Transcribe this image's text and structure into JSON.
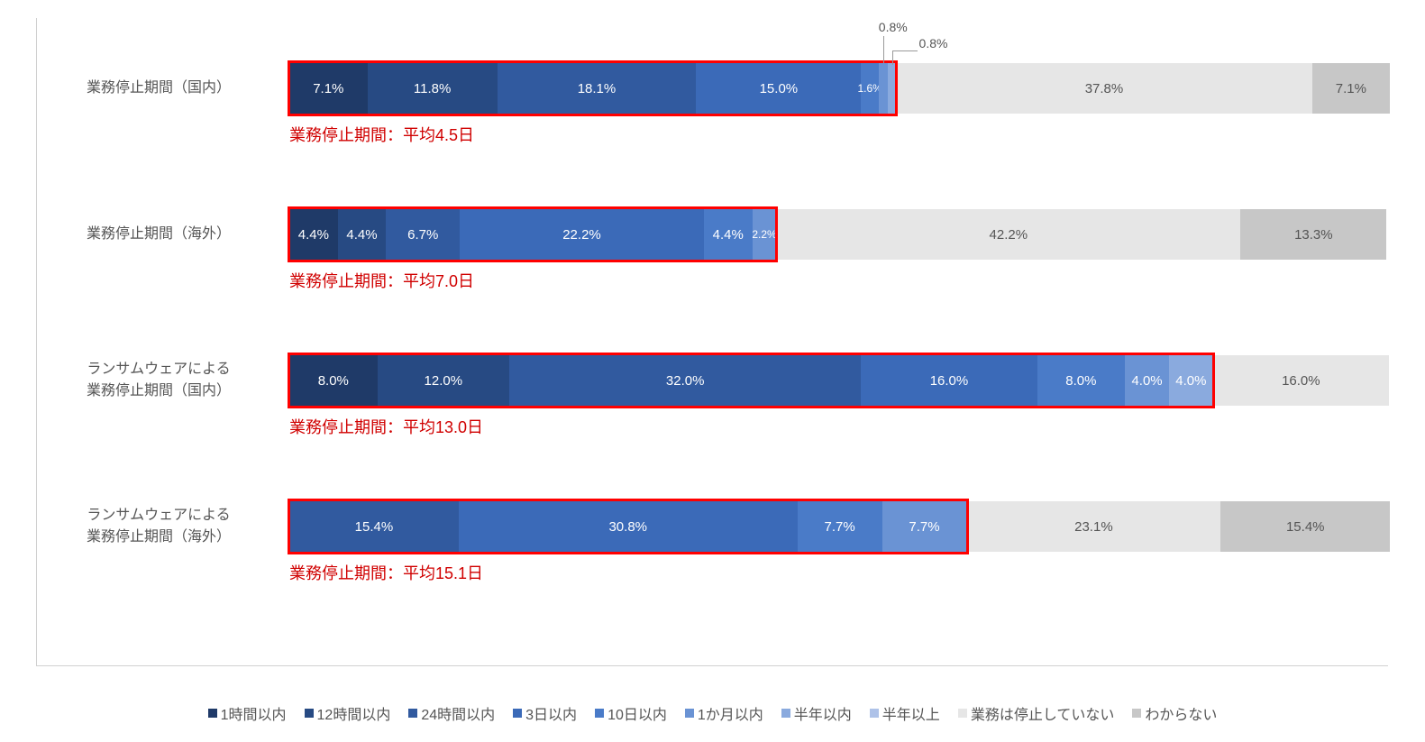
{
  "chart_data": {
    "type": "bar",
    "orientation": "horizontal-stacked",
    "xlim": [
      0,
      100
    ],
    "categories": [
      "業務停止期間（国内）",
      "業務停止期間（海外）",
      "ランサムウェアによる\n業務停止期間（国内）",
      "ランサムウェアによる\n業務停止期間（海外）"
    ],
    "series": [
      {
        "name": "1時間以内",
        "color": "#1f3a68",
        "values": [
          7.1,
          4.4,
          8.0,
          0
        ]
      },
      {
        "name": "12時間以内",
        "color": "#274a83",
        "values": [
          11.8,
          4.4,
          12.0,
          0
        ]
      },
      {
        "name": "24時間以内",
        "color": "#315a9f",
        "values": [
          18.1,
          6.7,
          32.0,
          15.4
        ]
      },
      {
        "name": "3日以内",
        "color": "#3b6ab8",
        "values": [
          15.0,
          22.2,
          16.0,
          30.8
        ]
      },
      {
        "name": "10日以内",
        "color": "#4a7bc8",
        "values": [
          1.6,
          4.4,
          8.0,
          7.7
        ]
      },
      {
        "name": "1か月以内",
        "color": "#6a93d4",
        "values": [
          0.8,
          2.2,
          4.0,
          7.7
        ]
      },
      {
        "name": "半年以内",
        "color": "#8aaade",
        "values": [
          0.8,
          0,
          4.0,
          0
        ]
      },
      {
        "name": "半年以上",
        "color": "#aec2e8",
        "values": [
          0,
          0,
          0,
          0
        ]
      },
      {
        "name": "業務は停止していない",
        "color": "#e6e6e6",
        "values": [
          37.8,
          42.2,
          16.0,
          23.1
        ]
      },
      {
        "name": "わからない",
        "color": "#c7c7c7",
        "values": [
          7.1,
          13.3,
          0,
          15.4
        ]
      }
    ],
    "annotations": [
      "業務停止期間：平均4.5日",
      "業務停止期間：平均7.0日",
      "業務停止期間：平均13.0日",
      "業務停止期間：平均15.1日"
    ],
    "highlight_box_end_series_index": [
      6,
      5,
      6,
      5
    ],
    "callouts_row0": [
      {
        "text": "0.8%",
        "series": 5
      },
      {
        "text": "0.8%",
        "series": 6
      }
    ],
    "label_overrides": {
      "1": {
        "5": "2.2%"
      }
    }
  },
  "legend": [
    {
      "label": "1時間以内",
      "color": "#1f3a68"
    },
    {
      "label": "12時間以内",
      "color": "#274a83"
    },
    {
      "label": "24時間以内",
      "color": "#315a9f"
    },
    {
      "label": "3日以内",
      "color": "#3b6ab8"
    },
    {
      "label": "10日以内",
      "color": "#4a7bc8"
    },
    {
      "label": "1か月以内",
      "color": "#6a93d4"
    },
    {
      "label": "半年以内",
      "color": "#8aaade"
    },
    {
      "label": "半年以上",
      "color": "#aec2e8"
    },
    {
      "label": "業務は停止していない",
      "color": "#e6e6e6"
    },
    {
      "label": "わからない",
      "color": "#c7c7c7"
    }
  ]
}
